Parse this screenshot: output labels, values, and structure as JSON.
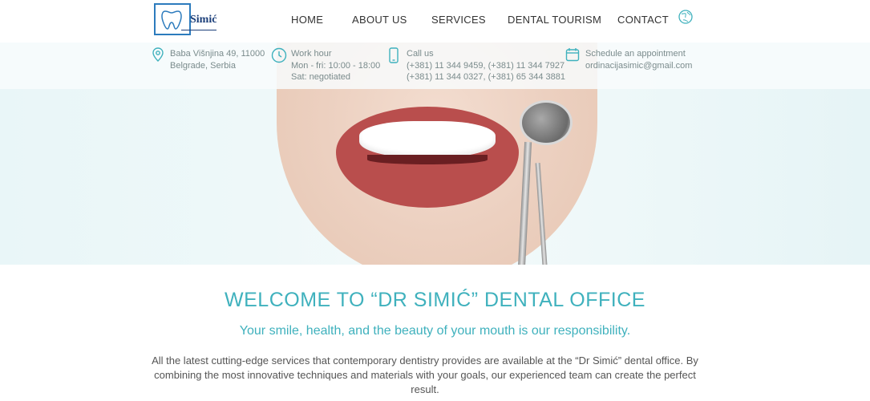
{
  "header": {
    "logo_text": "Simić",
    "nav": [
      "HOME",
      "ABOUT US",
      "SERVICES",
      "DENTAL TOURISM",
      "CONTACT"
    ]
  },
  "info_bar": {
    "address": {
      "line1": "Baba Višnjina 49, 11000",
      "line2": "Belgrade, Serbia"
    },
    "hours": {
      "label": "Work hour",
      "line1": "Mon - fri: 10:00 - 18:00",
      "line2": "Sat: negotiated"
    },
    "call": {
      "label": "Call us",
      "line1": "(+381) 11 344 9459, (+381) 11 344 7927",
      "line2": "(+381) 11 344 0327, (+381) 65 344 3881"
    },
    "appointment": {
      "label": "Schedule an appointment",
      "email": "ordinacijasimic@gmail.com"
    }
  },
  "main": {
    "title": "WELCOME TO “DR SIMIĆ” DENTAL OFFICE",
    "tagline": "Your smile, health, and the beauty of your mouth is our responsibility.",
    "body": "All the latest cutting-edge services that contemporary dentistry provides are available at the “Dr Simić” dental office. By combining the most innovative techniques and materials with your goals, our experienced team can create the perfect result."
  },
  "colors": {
    "accent": "#3fb1bd",
    "logo_blue": "#2c7bbd",
    "nav_text": "#333333"
  },
  "icons": [
    "location-pin-icon",
    "clock-icon",
    "phone-icon",
    "calendar-icon",
    "globe-icon"
  ]
}
